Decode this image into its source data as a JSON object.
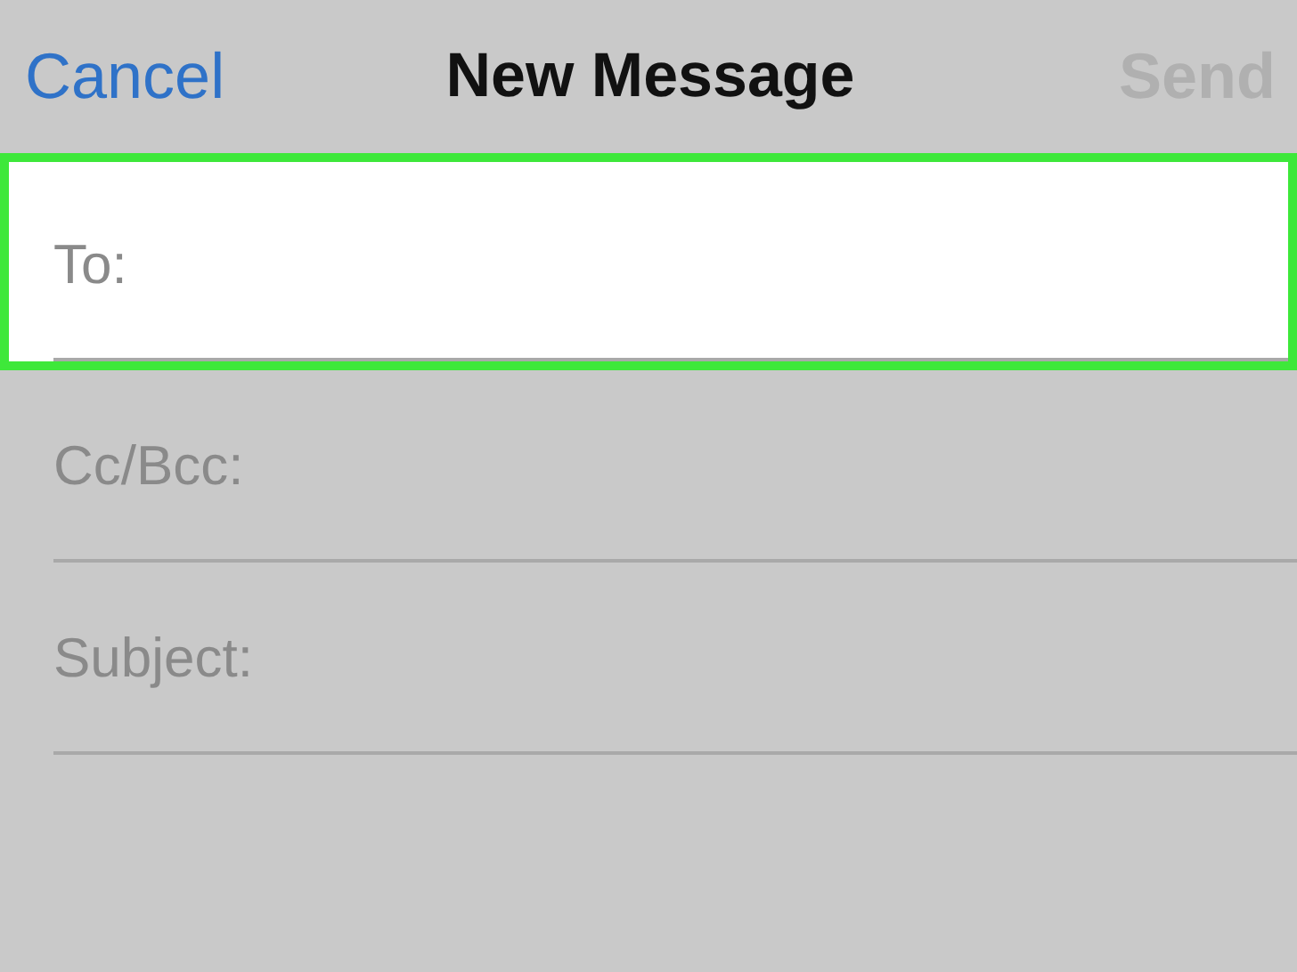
{
  "nav_bar": {
    "cancel": "Cancel",
    "title": "New Message",
    "send": {
      "label": "Send",
      "disabled": true
    }
  },
  "fields": [
    {
      "label": "To:",
      "highlighted": true
    },
    {
      "label": "Cc/Bcc:",
      "highlighted": false
    },
    {
      "label": "Subject:",
      "highlighted": false
    }
  ]
}
